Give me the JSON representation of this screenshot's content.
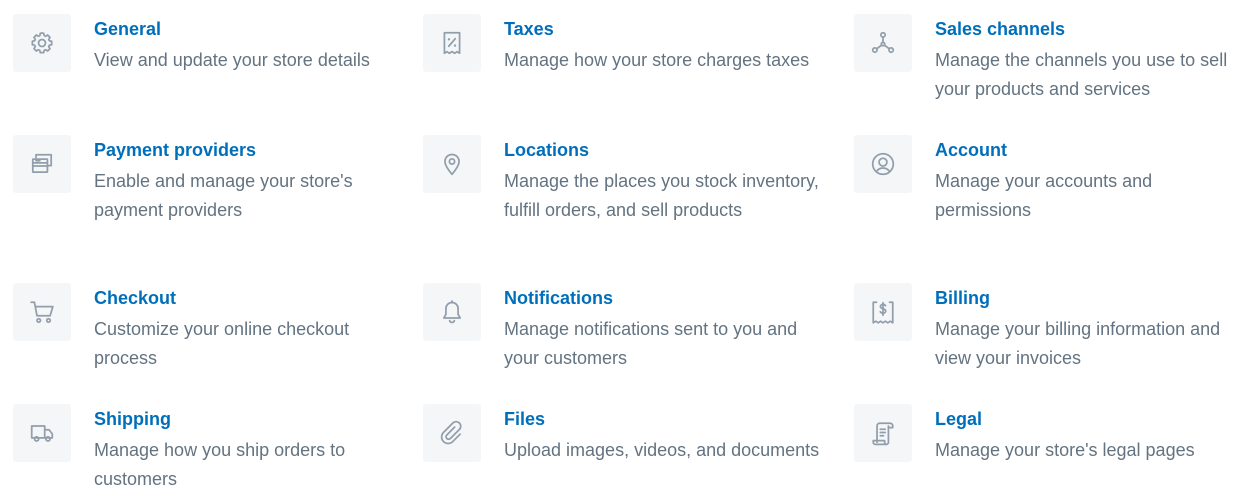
{
  "settings": {
    "general": {
      "title": "General",
      "description": "View and update your store details",
      "icon": "gear-icon"
    },
    "taxes": {
      "title": "Taxes",
      "description": "Manage how your store charges taxes",
      "icon": "receipt-percent-icon"
    },
    "sales_channels": {
      "title": "Sales channels",
      "description": "Manage the channels you use to sell your products and services",
      "icon": "channels-icon"
    },
    "payment_providers": {
      "title": "Payment providers",
      "description": "Enable and manage your store's payment providers",
      "icon": "credit-cards-icon"
    },
    "locations": {
      "title": "Locations",
      "description": "Manage the places you stock inventory, fulfill orders, and sell products",
      "icon": "location-pin-icon"
    },
    "account": {
      "title": "Account",
      "description": "Manage your accounts and permissions",
      "icon": "user-circle-icon"
    },
    "checkout": {
      "title": "Checkout",
      "description": "Customize your online checkout process",
      "icon": "cart-icon"
    },
    "notifications": {
      "title": "Notifications",
      "description": "Manage notifications sent to you and your customers",
      "icon": "bell-icon"
    },
    "billing": {
      "title": "Billing",
      "description": "Manage your billing information and view your invoices",
      "icon": "invoice-dollar-icon"
    },
    "shipping": {
      "title": "Shipping",
      "description": "Manage how you ship orders to customers",
      "icon": "truck-icon"
    },
    "files": {
      "title": "Files",
      "description": "Upload images, videos, and documents",
      "icon": "paperclip-icon"
    },
    "legal": {
      "title": "Legal",
      "description": "Manage your store's legal pages",
      "icon": "legal-document-icon"
    }
  },
  "colors": {
    "title_link": "#006fbb",
    "description_text": "#637381",
    "icon_stroke": "#919eab",
    "icon_background": "#f4f6f8"
  }
}
